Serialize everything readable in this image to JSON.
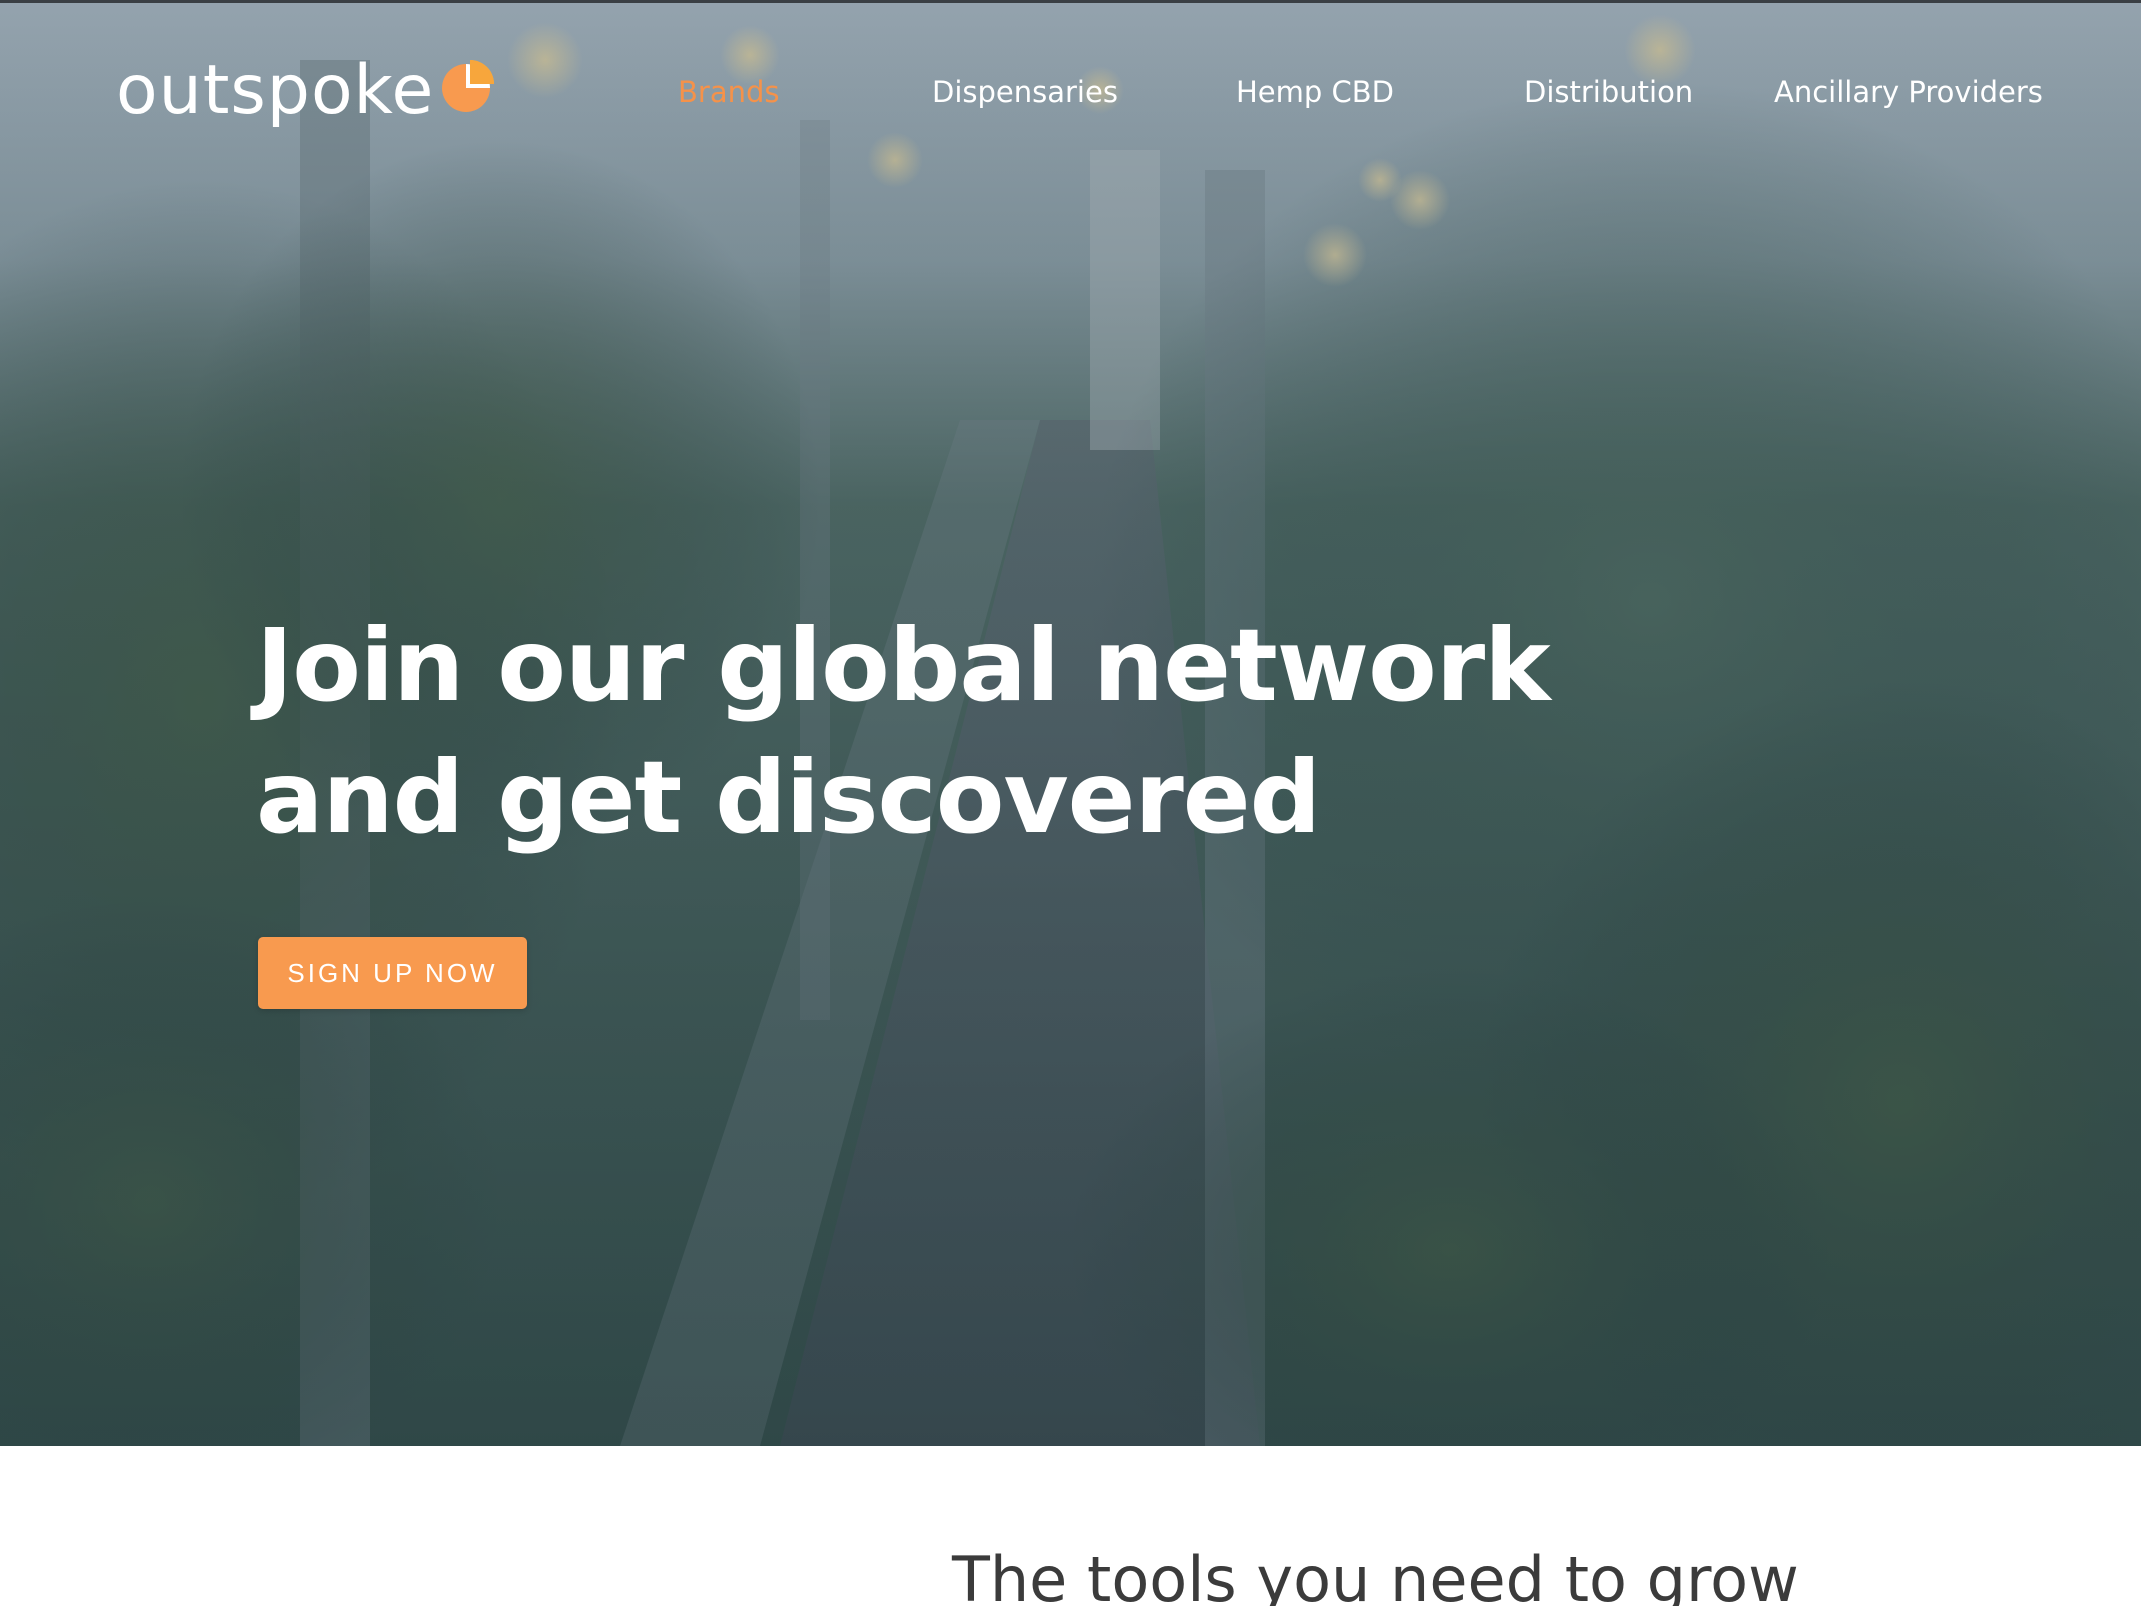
{
  "brand": {
    "logo_text": "outspoke",
    "logo_mark_icon": "pie-chart-icon",
    "accent_color": "#f89a4f"
  },
  "nav": {
    "items": [
      {
        "label": "Brands",
        "active": true
      },
      {
        "label": "Dispensaries",
        "active": false
      },
      {
        "label": "Hemp CBD",
        "active": false
      },
      {
        "label": "Distribution",
        "active": false
      },
      {
        "label": "Ancillary Providers",
        "active": false
      }
    ]
  },
  "hero": {
    "title_line1": "Join our global network",
    "title_line2": "and get discovered",
    "cta_label": "SIGN UP NOW",
    "background": "greenhouse-cannabis-plants-photo"
  },
  "section": {
    "title": "The tools you need to grow"
  }
}
